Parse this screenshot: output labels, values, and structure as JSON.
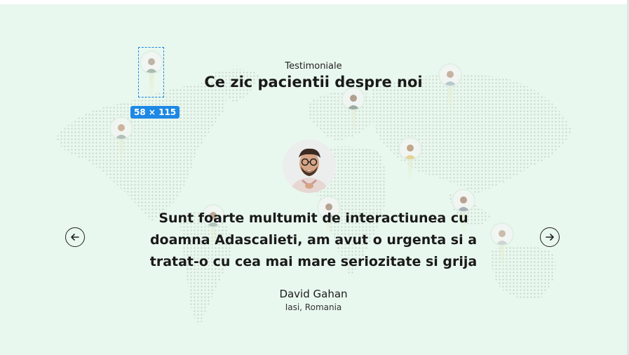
{
  "section": {
    "eyebrow": "Testimoniale",
    "title": "Ce zic pacientii despre noi"
  },
  "selection_overlay": {
    "size_label": "58 × 115",
    "color": "#1e88e5"
  },
  "testimonial": {
    "quote": "Sunt foarte multumit de interactiunea cu doamna Adascalieti, am avut o urgenta si a tratat-o cu cea mai mare seriozitate si grija",
    "author": "David Gahan",
    "location": "Iasi, Romania"
  },
  "navigation": {
    "prev_icon": "arrow-left-icon",
    "next_icon": "arrow-right-icon"
  },
  "colors": {
    "background": "#e9f8ee",
    "map_dots": "#c9d6cd",
    "text": "#1a1a1a"
  }
}
